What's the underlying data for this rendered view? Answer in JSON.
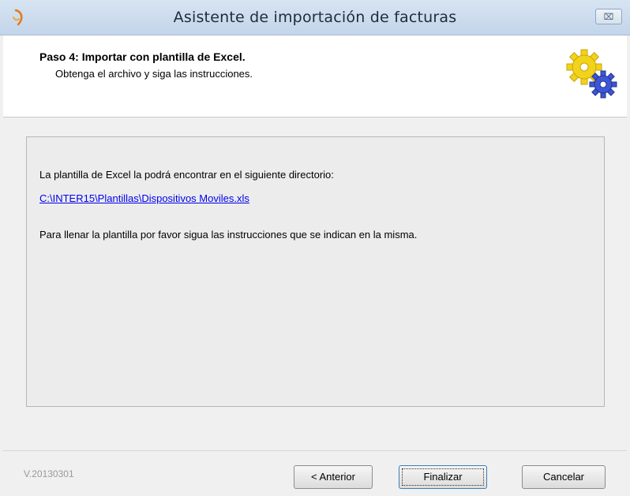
{
  "window": {
    "title": "Asistente de importación de facturas",
    "close_label": "⌧"
  },
  "header": {
    "step_title": "Paso 4: Importar con plantilla de Excel.",
    "step_subtitle": "Obtenga el archivo y siga las instrucciones."
  },
  "panel": {
    "line1": "La plantilla de Excel la podrá encontrar en el siguiente directorio:",
    "link": "C:\\INTER15\\Plantillas\\Dispositivos Moviles.xls",
    "line2": "Para llenar la plantilla por favor sigua las instrucciones que se indican en la misma."
  },
  "footer": {
    "version": "V.20130301",
    "anterior_label": "< Anterior",
    "finalizar_label": "Finalizar",
    "cancelar_label": "Cancelar"
  },
  "icons": {
    "app": "app-icon",
    "gears": "gears-icon",
    "close": "close-icon"
  },
  "colors": {
    "link": "#0000ee",
    "gear_yellow": "#f2d21a",
    "gear_blue": "#3d56d6"
  }
}
